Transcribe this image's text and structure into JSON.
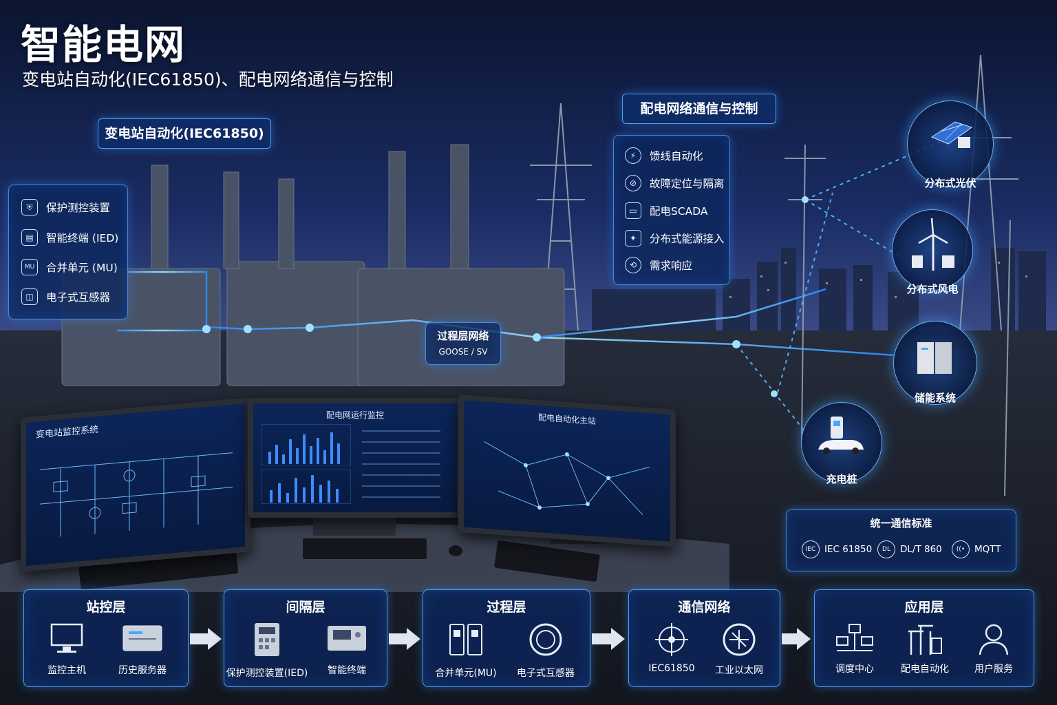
{
  "header": {
    "title": "智能电网",
    "subtitle": "变电站自动化(IEC61850)、配电网络通信与控制"
  },
  "substation": {
    "tag": "变电站自动化(IEC61850)",
    "items": [
      {
        "icon": "shield-icon",
        "label": "保护测控装置"
      },
      {
        "icon": "ied-icon",
        "label": "智能终端 (IED)"
      },
      {
        "icon": "mu-icon",
        "label": "合并单元 (MU)"
      },
      {
        "icon": "transformer-icon",
        "label": "电子式互感器"
      }
    ]
  },
  "process_network": {
    "title": "过程层网络",
    "protocol": "GOOSE / SV"
  },
  "distribution": {
    "tag": "配电网络通信与控制",
    "items": [
      {
        "icon": "feeder-icon",
        "label": "馈线自动化"
      },
      {
        "icon": "fault-icon",
        "label": "故障定位与隔离"
      },
      {
        "icon": "scada-icon",
        "label": "配电SCADA"
      },
      {
        "icon": "der-icon",
        "label": "分布式能源接入"
      },
      {
        "icon": "demand-icon",
        "label": "需求响应"
      }
    ]
  },
  "resources": [
    {
      "icon": "solar-panel-icon",
      "label": "分布式光伏"
    },
    {
      "icon": "wind-turbine-icon",
      "label": "分布式风电"
    },
    {
      "icon": "battery-storage-icon",
      "label": "储能系统"
    },
    {
      "icon": "ev-charger-icon",
      "label": "充电桩"
    }
  ],
  "standards": {
    "title": "统一通信标准",
    "items": [
      {
        "icon": "iec-icon",
        "badge": "IEC",
        "label": "IEC 61850"
      },
      {
        "icon": "dlt-icon",
        "badge": "DL",
        "label": "DL/T 860"
      },
      {
        "icon": "mqtt-icon",
        "badge": "((•",
        "label": "MQTT"
      }
    ]
  },
  "monitors": {
    "left": "变电站监控系统",
    "center": "配电网运行监控",
    "right": "配电自动化主站"
  },
  "layers": [
    {
      "title": "站控层",
      "items": [
        {
          "icon": "monitor-host-icon",
          "label": "监控主机"
        },
        {
          "icon": "history-server-icon",
          "label": "历史服务器"
        }
      ]
    },
    {
      "title": "间隔层",
      "items": [
        {
          "icon": "protection-device-icon",
          "label": "保护测控装置(IED)"
        },
        {
          "icon": "smart-terminal-icon",
          "label": "智能终端"
        }
      ]
    },
    {
      "title": "过程层",
      "items": [
        {
          "icon": "merging-unit-icon",
          "label": "合并单元(MU)"
        },
        {
          "icon": "instrument-transformer-icon",
          "label": "电子式互感器"
        }
      ]
    },
    {
      "title": "通信网络",
      "items": [
        {
          "icon": "iec61850-network-icon",
          "label": "IEC61850"
        },
        {
          "icon": "ethernet-icon",
          "label": "工业以太网"
        }
      ]
    },
    {
      "title": "应用层",
      "items": [
        {
          "icon": "dispatch-center-icon",
          "label": "调度中心"
        },
        {
          "icon": "distribution-automation-icon",
          "label": "配电自动化"
        },
        {
          "icon": "user-service-icon",
          "label": "用户服务"
        }
      ]
    }
  ]
}
